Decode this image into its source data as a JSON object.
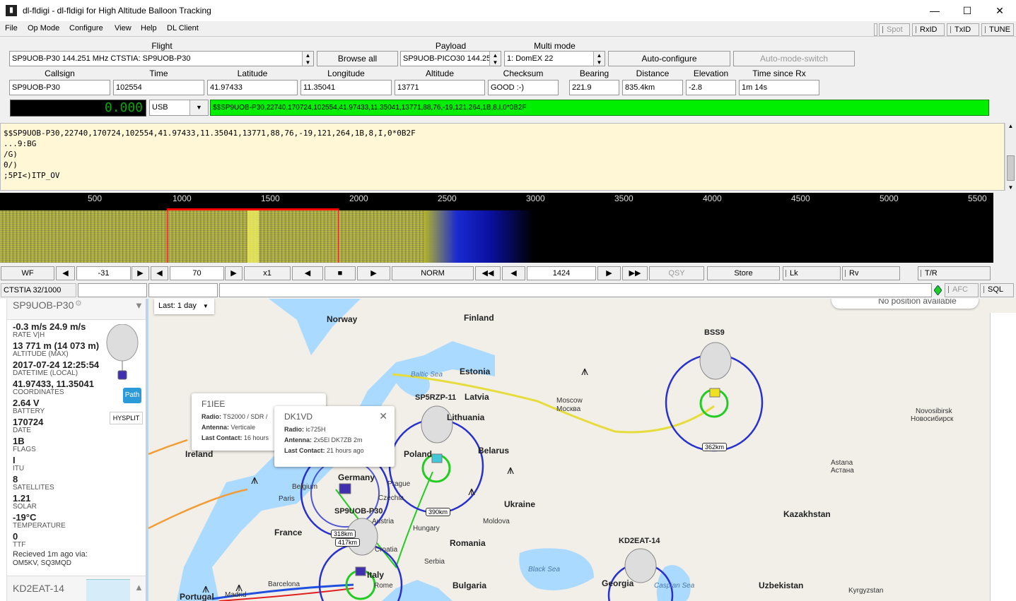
{
  "window": {
    "title": "dl-fldigi - dl-fldigi for High Altitude Balloon Tracking",
    "icon": "dl-fldigi-icon"
  },
  "menu": [
    "File",
    "Op Mode",
    "Configure",
    "View",
    "Help",
    "DL Client"
  ],
  "top_buttons": {
    "spot": "Spot",
    "rxid": "RxID",
    "txid": "TxID",
    "tune": "TUNE"
  },
  "flight": {
    "flight_label": "Flight",
    "flight_value": "SP9UOB-P30 144.251 MHz CTSTIA: SP9UOB-P30",
    "browse_all": "Browse all",
    "payload_label": "Payload",
    "payload_value": "SP9UOB-PICO30 144.25",
    "multimode_label": "Multi mode",
    "multimode_value": "1: DomEX 22",
    "autoconfigure": "Auto-configure",
    "automode": "Auto-mode-switch"
  },
  "telemetry": {
    "headers": [
      "Callsign",
      "Time",
      "Latitude",
      "Longitude",
      "Altitude",
      "Checksum",
      "Bearing",
      "Distance",
      "Elevation",
      "Time since Rx"
    ],
    "values": [
      "SP9UOB-P30",
      "102554",
      "41.97433",
      "11.35041",
      "13771",
      "GOOD :-)",
      "221.9",
      "835.4km",
      "-2.8",
      "1m 14s"
    ]
  },
  "freq": {
    "display": "0.000",
    "mode": "USB",
    "sentence": "$$SP9UOB-P30,22740,170724,102554,41.97433,11.35041,13771,88,76,-19,121,264,1B,8,I,0*0B2F"
  },
  "rx_lines": [
    "$$SP9UOB-P30,22740,170724,102554,41.97433,11.35041,13771,88,76,-19,121,264,1B,8,I,0*0B2F",
    "...9:BG",
    "/G)",
    "0/)",
    ";5PI<)ITP_OV"
  ],
  "scale_labels": [
    "500",
    "1000",
    "1500",
    "2000",
    "2500",
    "3000",
    "3500",
    "4000",
    "4500",
    "5000",
    "5500"
  ],
  "wf_controls": {
    "wf": "WF",
    "att": "-31",
    "range": "70",
    "zoom": "x1",
    "speed": "NORM",
    "carrier": "1424",
    "qsy": "QSY",
    "store": "Store",
    "lk": "Lk",
    "rv": "Rv",
    "tr": "T/R"
  },
  "status": {
    "mode": "CTSTIA 32/1000",
    "afc": "AFC",
    "sql": "SQL"
  },
  "tracker": {
    "callsign": "SP9UOB-P30",
    "filter": "Last: 1 day",
    "path_btn": "Path",
    "hysplit_btn": "HYSPLIT",
    "fields": [
      {
        "value": "-0.3 m/s 24.9 m/s",
        "label": "RATE V|H"
      },
      {
        "value": "13 771 m (14 073 m)",
        "label": "ALTITUDE (MAX)"
      },
      {
        "value": "2017-07-24 12:25:54",
        "label": "DATETIME (LOCAL)"
      },
      {
        "value": "41.97433, 11.35041",
        "label": "COORDINATES"
      },
      {
        "value": "2.64 V",
        "label": "BATTERY"
      },
      {
        "value": "170724",
        "label": "DATE"
      },
      {
        "value": "1B",
        "label": "FLAGS"
      },
      {
        "value": "I",
        "label": "ITU"
      },
      {
        "value": "8",
        "label": "SATELLITES"
      },
      {
        "value": "1.21",
        "label": "SOLAR"
      },
      {
        "value": "-19°C",
        "label": "TEMPERATURE"
      },
      {
        "value": "0",
        "label": "TTF"
      }
    ],
    "received": "Recieved 1m ago via:",
    "received_via": "OM5KV, SQ3MQD",
    "next_callsign": "KD2EAT-14"
  },
  "popups": {
    "f1iee": {
      "title": "F1IEE",
      "radio": "TS2000 / SDR / ",
      "antenna": "Verticale",
      "last": "16 hours"
    },
    "dk1vd": {
      "title": "DK1VD",
      "radio": "ic725H",
      "antenna": "2x5El DK7ZB 2m",
      "last": "21 hours ago"
    },
    "labels": {
      "radio": "Radio:",
      "antenna": "Antenna:",
      "last": "Last Contact:"
    }
  },
  "map": {
    "no_position": "No position available",
    "countries": [
      "Norway",
      "Finland",
      "Estonia",
      "Latvia",
      "Lithuania",
      "Belarus",
      "Poland",
      "Germany",
      "Ukraine",
      "France",
      "Romania",
      "Kazakhstan",
      "Bulgaria",
      "Italy",
      "Georgia",
      "Uzbekistan",
      "Ireland",
      "Portugal"
    ],
    "cities": [
      "Moscow",
      "Москва",
      "Novosibirsk",
      "Новосибирск",
      "Astana",
      "Астана",
      "Paris",
      "Belgium",
      "Prague",
      "Czechia",
      "Austria",
      "Hungary",
      "Croatia",
      "Serbia",
      "Moldova",
      "Barcelona",
      "Madrid",
      "Rome",
      "Kyrgyzstan"
    ],
    "seas": [
      "Baltic Sea",
      "Black Sea",
      "Caspian Sea"
    ],
    "callsigns": [
      "BSS9",
      "SP5RZP-11",
      "SP9UOB-P30",
      "KD2EAT-14"
    ],
    "ranges": [
      "362km",
      "390km",
      "318km",
      "417km"
    ],
    "colors": {
      "land": "#f2efe9",
      "water": "#aadaff",
      "route_yellow": "#e6dc3c",
      "route_orange": "#f39c34",
      "route_blue": "#2050e0"
    }
  }
}
